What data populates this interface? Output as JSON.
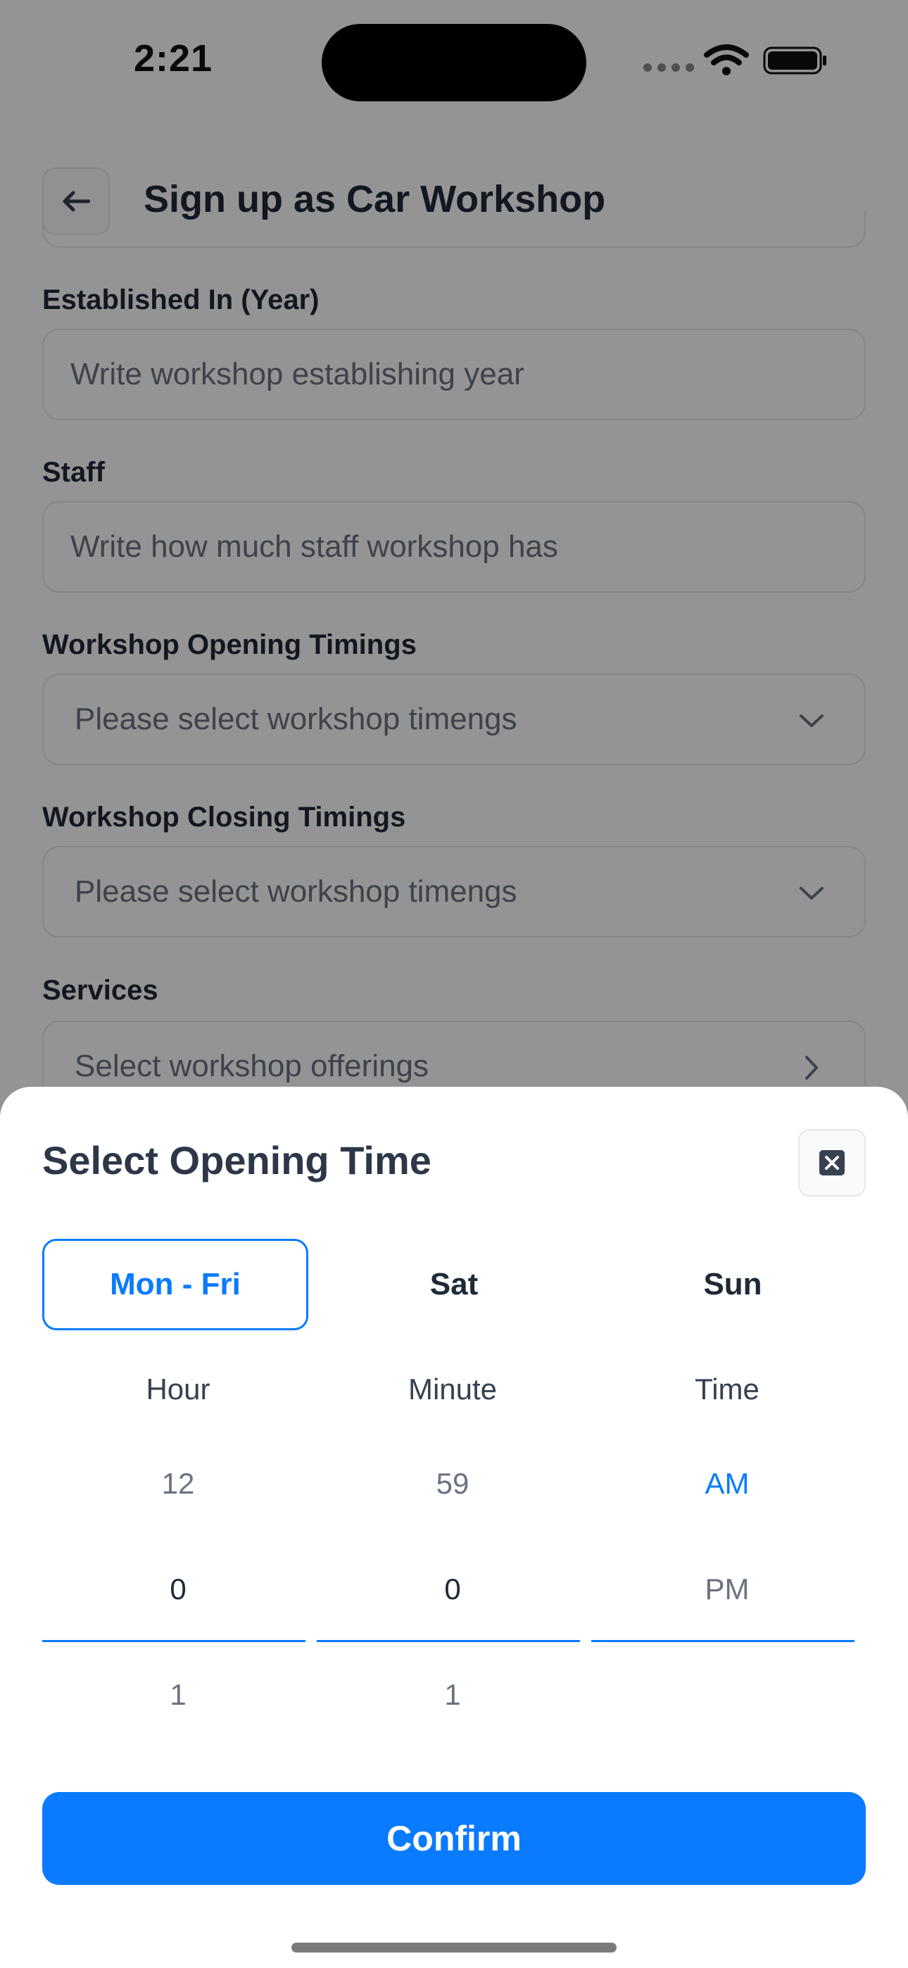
{
  "status_bar": {
    "time": "2:21"
  },
  "header": {
    "title": "Sign up as Car Workshop"
  },
  "form": {
    "established": {
      "label": "Established In (Year)",
      "placeholder": "Write workshop establishing year"
    },
    "staff": {
      "label": "Staff",
      "placeholder": "Write how much staff workshop has"
    },
    "opening": {
      "label": "Workshop Opening Timings",
      "placeholder": "Please select workshop timengs"
    },
    "closing": {
      "label": "Workshop Closing Timings",
      "placeholder": "Please select workshop timengs"
    },
    "services": {
      "label": "Services",
      "placeholder": "Select workshop offerings"
    }
  },
  "sheet": {
    "title": "Select Opening Time",
    "tabs": [
      {
        "label": "Mon - Fri",
        "active": true
      },
      {
        "label": "Sat",
        "active": false
      },
      {
        "label": "Sun",
        "active": false
      }
    ],
    "columns": {
      "hour": {
        "label": "Hour",
        "values": [
          "12",
          "0",
          "1"
        ]
      },
      "minute": {
        "label": "Minute",
        "values": [
          "59",
          "0",
          "1"
        ]
      },
      "time": {
        "label": "Time",
        "values": [
          "AM",
          "PM"
        ]
      }
    },
    "confirm_label": "Confirm"
  },
  "colors": {
    "accent": "#0a7bff",
    "overlay": "rgba(0,0,0,0.42)"
  },
  "icons": [
    "back-arrow-icon",
    "chevron-down-icon",
    "chevron-right-icon",
    "close-icon",
    "wifi-icon",
    "battery-icon",
    "signal-icon"
  ]
}
